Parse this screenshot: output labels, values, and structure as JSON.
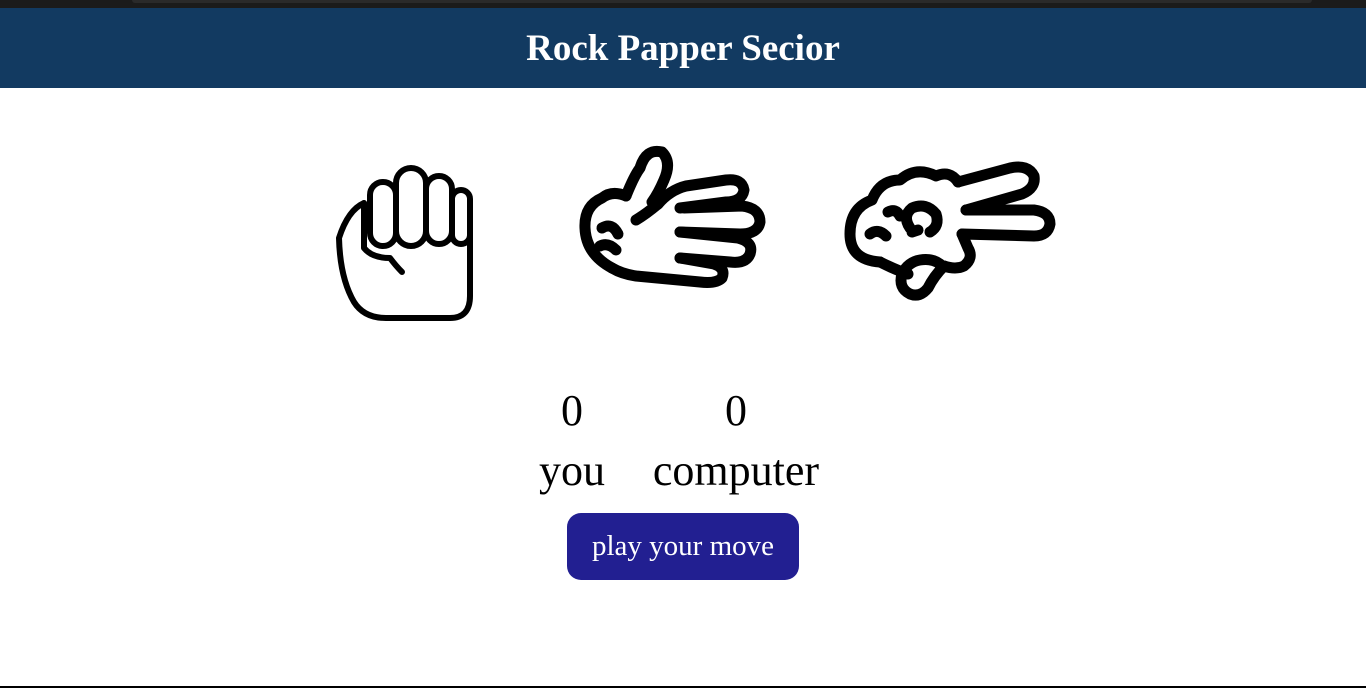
{
  "header": {
    "title": "Rock Papper Secior",
    "background": "#123a61"
  },
  "choices": [
    {
      "name": "rock",
      "icon": "rock-fist-icon"
    },
    {
      "name": "paper",
      "icon": "paper-open-hand-icon"
    },
    {
      "name": "scissors",
      "icon": "scissors-hand-icon"
    }
  ],
  "scoreboard": {
    "you": {
      "score": "0",
      "label": "you"
    },
    "computer": {
      "score": "0",
      "label": "computer"
    }
  },
  "play_button": {
    "label": "play your move",
    "color": "#221f91"
  }
}
